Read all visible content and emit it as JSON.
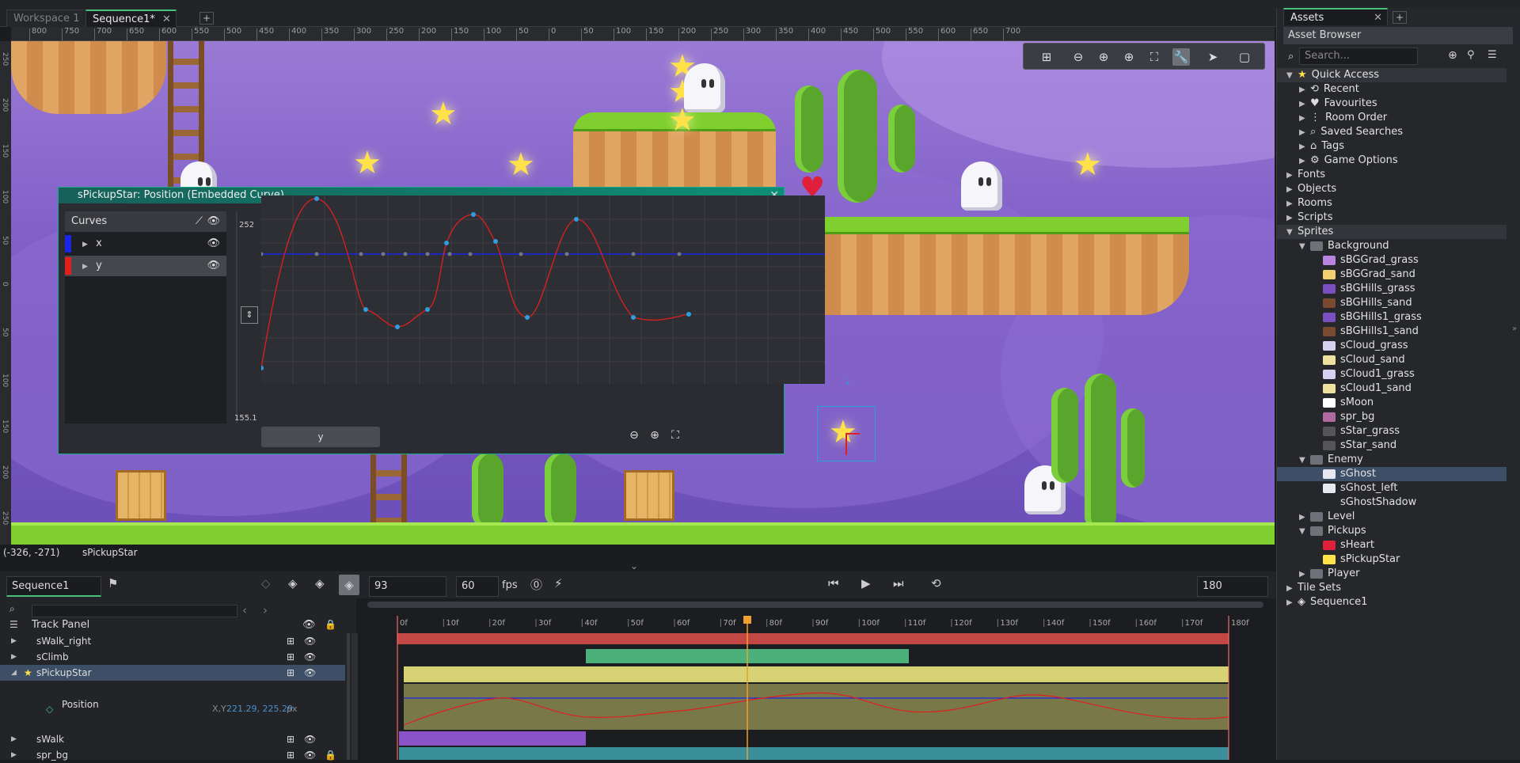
{
  "workspace_tabs": [
    {
      "label": "Workspace 1",
      "active": false
    },
    {
      "label": "Sequence1*",
      "active": true
    }
  ],
  "ruler_top": [
    "800",
    "750",
    "700",
    "650",
    "600",
    "550",
    "500",
    "450",
    "400",
    "350",
    "300",
    "250",
    "200",
    "150",
    "100",
    "50",
    "0",
    "50",
    "100",
    "150",
    "200",
    "250",
    "300",
    "350",
    "400",
    "450",
    "500",
    "550",
    "600",
    "650",
    "700"
  ],
  "ruler_left": [
    "250",
    "200",
    "150",
    "100",
    "50",
    "0",
    "50",
    "100",
    "150",
    "200",
    "250"
  ],
  "curve_window": {
    "title": "sPickupStar: Position (Embedded Curve)",
    "panel_header": "Curves",
    "curves": [
      {
        "label": "x",
        "color": "#1a25e6"
      },
      {
        "label": "y",
        "color": "#e01f1f"
      }
    ],
    "y_max": "252",
    "y_min": "155.1",
    "bottom_tab": "y"
  },
  "status": {
    "coords": "(-326, -271)",
    "object": "sPickupStar"
  },
  "sequence": {
    "tab_label": "Sequence1",
    "frame": "93",
    "fps_value": "60",
    "fps_label": "fps",
    "length": "180"
  },
  "track_panel": {
    "title": "Track Panel",
    "search_placeholder": "",
    "tracks": [
      {
        "name": "sWalk_right",
        "selected": false
      },
      {
        "name": "sClimb",
        "selected": false
      },
      {
        "name": "sPickupStar",
        "selected": true
      },
      {
        "name": "sWalk",
        "selected": false
      },
      {
        "name": "spr_bg",
        "selected": false
      }
    ],
    "position_label": "Position",
    "xy_label": "X,Y",
    "xy_value": "221.29, 225.29",
    "xy_unit": "px"
  },
  "timeline_ticks": [
    "0f",
    "10f",
    "20f",
    "30f",
    "40f",
    "50f",
    "60f",
    "70f",
    "80f",
    "90f",
    "100f",
    "110f",
    "120f",
    "130f",
    "140f",
    "150f",
    "160f",
    "170f",
    "180f"
  ],
  "assets": {
    "tab": "Assets",
    "title": "Asset Browser",
    "search_placeholder": "Search...",
    "items": [
      {
        "label": "Quick Access",
        "level": 0,
        "expanded": true,
        "icon": "star"
      },
      {
        "label": "Recent",
        "level": 1,
        "icon": "history"
      },
      {
        "label": "Favourites",
        "level": 1,
        "icon": "heart"
      },
      {
        "label": "Room Order",
        "level": 1,
        "icon": "tree"
      },
      {
        "label": "Saved Searches",
        "level": 1,
        "icon": "search"
      },
      {
        "label": "Tags",
        "level": 1,
        "icon": "tag"
      },
      {
        "label": "Game Options",
        "level": 1,
        "icon": "gear"
      },
      {
        "label": "Fonts",
        "level": 0
      },
      {
        "label": "Objects",
        "level": 0
      },
      {
        "label": "Rooms",
        "level": 0
      },
      {
        "label": "Scripts",
        "level": 0
      },
      {
        "label": "Sprites",
        "level": 0,
        "expanded": true
      },
      {
        "label": "Background",
        "level": 1,
        "expanded": true,
        "folder": true
      },
      {
        "label": "sBGGrad_grass",
        "level": 2,
        "swatch": "#b784e0"
      },
      {
        "label": "sBGGrad_sand",
        "level": 2,
        "swatch": "#f0d070"
      },
      {
        "label": "sBGHills_grass",
        "level": 2,
        "swatch": "#7a4fc0"
      },
      {
        "label": "sBGHills_sand",
        "level": 2,
        "swatch": "#7a4a30"
      },
      {
        "label": "sBGHills1_grass",
        "level": 2,
        "swatch": "#7a4fc0"
      },
      {
        "label": "sBGHills1_sand",
        "level": 2,
        "swatch": "#7a4a30"
      },
      {
        "label": "sCloud_grass",
        "level": 2,
        "swatch": "#d8d0f0"
      },
      {
        "label": "sCloud_sand",
        "level": 2,
        "swatch": "#f0e0a0"
      },
      {
        "label": "sCloud1_grass",
        "level": 2,
        "swatch": "#d8d0f0"
      },
      {
        "label": "sCloud1_sand",
        "level": 2,
        "swatch": "#f0e0a0"
      },
      {
        "label": "sMoon",
        "level": 2,
        "swatch": "#ffffff"
      },
      {
        "label": "spr_bg",
        "level": 2,
        "swatch": "#b06aa0"
      },
      {
        "label": "sStar_grass",
        "level": 2,
        "swatch": "#555"
      },
      {
        "label": "sStar_sand",
        "level": 2,
        "swatch": "#555"
      },
      {
        "label": "Enemy",
        "level": 1,
        "expanded": true,
        "folder": true
      },
      {
        "label": "sGhost",
        "level": 2,
        "swatch": "#e8e8f0",
        "selected": true
      },
      {
        "label": "sGhost_left",
        "level": 2,
        "swatch": "#e8e8f0"
      },
      {
        "label": "sGhostShadow",
        "level": 2,
        "swatch": ""
      },
      {
        "label": "Level",
        "level": 1,
        "folder": true
      },
      {
        "label": "Pickups",
        "level": 1,
        "expanded": true,
        "folder": true
      },
      {
        "label": "sHeart",
        "level": 2,
        "swatch": "#e0203a"
      },
      {
        "label": "sPickupStar",
        "level": 2,
        "swatch": "#ffe24a"
      },
      {
        "label": "Player",
        "level": 1,
        "folder": true
      },
      {
        "label": "Tile Sets",
        "level": 0
      },
      {
        "label": "Sequence1",
        "level": 0,
        "icon": "sequence"
      }
    ]
  },
  "colors": {
    "accent": "#48c27a",
    "curve_x": "#1a25e6",
    "curve_y": "#e01f1f",
    "playhead": "#f0a030",
    "selection": "#3d4f66"
  }
}
